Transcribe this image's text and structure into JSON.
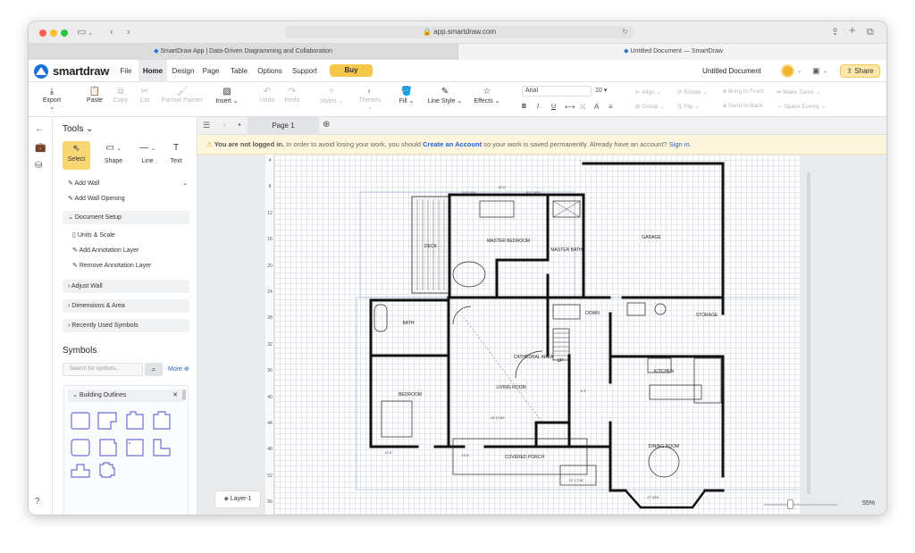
{
  "browser": {
    "url": "app.smartdraw.com",
    "tabs": [
      {
        "title": "SmartDraw App | Data-Driven Diagramming and Collaboration"
      },
      {
        "title": "Untitled Document — SmartDraw"
      }
    ]
  },
  "app": {
    "logo_text": "smartdraw",
    "menus": [
      "File",
      "Home",
      "Design",
      "Page",
      "Table",
      "Options",
      "Support"
    ],
    "active_menu": "Home",
    "buy_label": "Buy",
    "document_title": "Untitled Document",
    "share_label": "Share"
  },
  "toolbar": {
    "export": "Export",
    "paste": "Paste",
    "copy": "Copy",
    "cut": "Cut",
    "format_painter": "Format Painter",
    "insert": "Insert",
    "undo": "Undo",
    "redo": "Redo",
    "styles": "Styles",
    "themes": "Themes",
    "fill": "Fill",
    "line_style": "Line Style",
    "effects": "Effects",
    "font_name": "Arial",
    "font_size": "10",
    "align": "Align",
    "rotate": "Rotate",
    "bring_to_front": "Bring to Front",
    "make_same": "Make Same",
    "group": "Group",
    "flip": "Flip",
    "send_to_back": "Send to Back",
    "space_evenly": "Space Evenly",
    "format_buttons": [
      "B",
      "I",
      "U"
    ]
  },
  "panel": {
    "tools_title": "Tools",
    "tools": [
      {
        "label": "Select",
        "icon": "pointer-icon"
      },
      {
        "label": "Shape",
        "icon": "rectangle-icon"
      },
      {
        "label": "Line",
        "icon": "line-icon"
      },
      {
        "label": "Text",
        "icon": "text-icon"
      }
    ],
    "add_wall": "Add Wall",
    "add_wall_opening": "Add Wall Opening",
    "document_setup": "Document Setup",
    "units_scale": "Units & Scale",
    "add_annotation_layer": "Add Annotation Layer",
    "remove_annotation_layer": "Remove Annotation Layer",
    "adjust_wall": "Adjust Wall",
    "dimensions_area": "Dimensions & Area",
    "recently_used": "Recently Used Symbols",
    "symbols_title": "Symbols",
    "search_placeholder": "Search for symbols...",
    "more_label": "More",
    "library_name": "Building Outlines"
  },
  "canvas": {
    "page_tab": "Page 1",
    "notice_prefix": "You are not logged in.",
    "notice_mid": " In order to avoid losing your work, you should ",
    "create_account": "Create an Account",
    "notice_mid2": " so your work is saved permanently. Already have an account? ",
    "sign_in": "Sign in.",
    "layer_label": "Layer-1",
    "zoom": "55%",
    "ruler_marks": [
      "4",
      "8",
      "12",
      "16",
      "20",
      "24",
      "28",
      "32",
      "36",
      "40",
      "44",
      "48",
      "52",
      "56"
    ]
  },
  "floorplan": {
    "rooms": [
      "MASTER BEDROOM",
      "MASTER BATH",
      "GARAGE",
      "DECK",
      "BATH",
      "DOWN",
      "STORAGE",
      "CATHEDRAL AREA",
      "LIVING ROOM",
      "BEDROOM",
      "KITCHEN",
      "DINING ROOM",
      "COVERED PORCH",
      "UP"
    ],
    "dimensions": [
      "20' 0\"",
      "3' 0\" 1/16\"",
      "8' 1\" 3/16\"",
      "15' 11 3/4\"",
      "17' 3/16\"",
      "19' 1 7/16\"",
      "5' 0\"",
      "10' 6\"",
      "13' 6\""
    ]
  }
}
